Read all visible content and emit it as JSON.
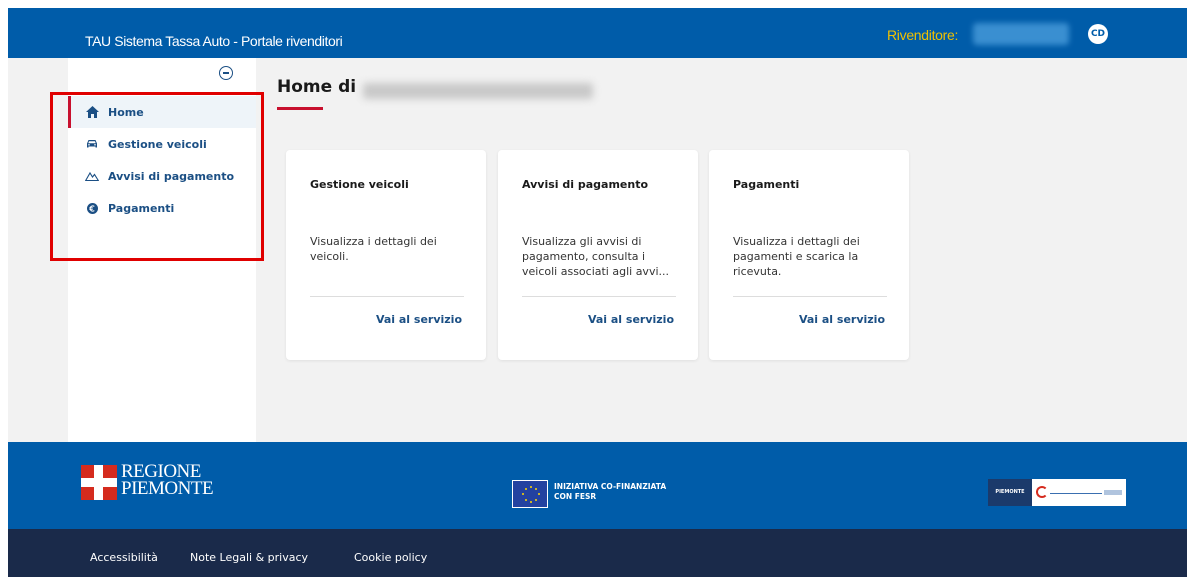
{
  "header": {
    "app_title": "TAU Sistema Tassa Auto - Portale rivenditori",
    "reseller_label": "Rivenditore:",
    "avatar_initials": "CD"
  },
  "sidebar": {
    "items": [
      {
        "label": "Home",
        "icon": "home-icon",
        "active": true
      },
      {
        "label": "Gestione veicoli",
        "icon": "car-icon",
        "active": false
      },
      {
        "label": "Avvisi di pagamento",
        "icon": "mountain-icon",
        "active": false
      },
      {
        "label": "Pagamenti",
        "icon": "euro-icon",
        "active": false
      }
    ]
  },
  "main": {
    "title_prefix": "Home di",
    "cards": [
      {
        "title": "Gestione veicoli",
        "text": "Visualizza i dettagli dei veicoli.",
        "link": "Vai al servizio"
      },
      {
        "title": "Avvisi di pagamento",
        "text": "Visualizza gli avvisi di pagamento, consulta i veicoli associati agli avvi...",
        "link": "Vai al servizio"
      },
      {
        "title": "Pagamenti",
        "text": "Visualizza i dettagli dei pagamenti e scarica la ricevuta.",
        "link": "Vai al servizio"
      }
    ]
  },
  "footer": {
    "logo_line1": "REGIONE",
    "logo_line2": "PIEMONTE",
    "eu_line1": "INIZIATIVA CO-FINANZIATA",
    "eu_line2": "CON FESR",
    "partner_logo_text": "PIEMONTE"
  },
  "bottom_links": {
    "accessibility": "Accessibilità",
    "legal": "Note Legali & privacy",
    "cookie": "Cookie policy"
  },
  "colors": {
    "primary": "#005ca9",
    "accent_red": "#c8102e",
    "reseller_label": "#f0c000",
    "bottom_bar": "#1a2a4a"
  }
}
